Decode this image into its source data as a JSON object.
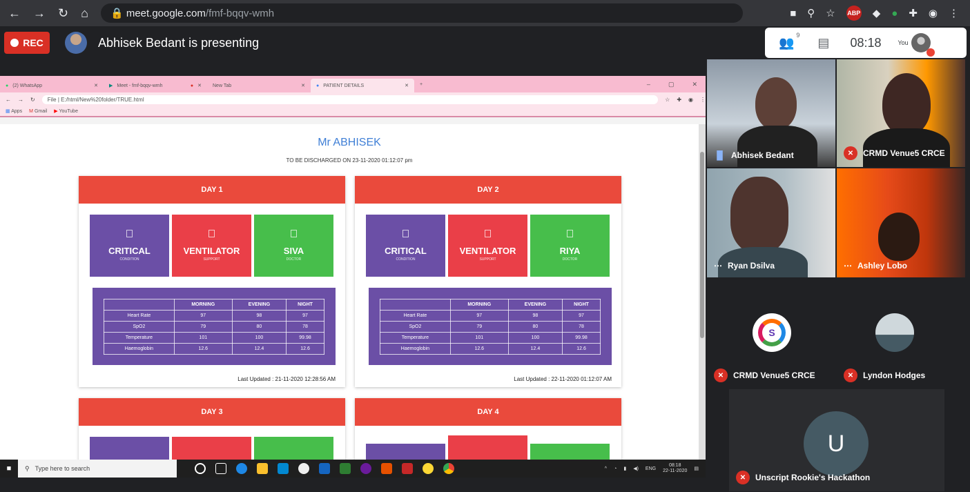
{
  "browser": {
    "url_domain": "meet.google.com",
    "url_path": "/fmf-bqqv-wmh"
  },
  "meet": {
    "rec_label": "REC",
    "presenting_text": "Abhisek Bedant is presenting",
    "participants_count": "9",
    "time": "08:18",
    "you_label": "You"
  },
  "inner_browser": {
    "tabs": [
      {
        "label": "(2) WhatsApp"
      },
      {
        "label": "Meet - fmf-bqqv-wmh"
      },
      {
        "label": "New Tab"
      },
      {
        "label": "PATIENT DETAILS"
      }
    ],
    "address": "File | E:/html/New%20folder/TRUE.html",
    "bookmarks": [
      "Apps",
      "Gmail",
      "YouTube"
    ]
  },
  "patient": {
    "name": "Mr ABHISEK",
    "discharge": "TO BE DISCHARGED ON 23-11-2020 01:12:07 pm"
  },
  "days": [
    {
      "title": "DAY 1",
      "tiles": [
        {
          "title": "CRITICAL",
          "sub": "CONDITION"
        },
        {
          "title": "VENTILATOR",
          "sub": "SUPPORT"
        },
        {
          "title": "SIVA",
          "sub": "DOCTOR"
        }
      ],
      "updated": "Last Updated : 21-11-2020 12:28:56 AM"
    },
    {
      "title": "DAY 2",
      "tiles": [
        {
          "title": "CRITICAL",
          "sub": "CONDITION"
        },
        {
          "title": "VENTILATOR",
          "sub": "SUPPORT"
        },
        {
          "title": "RIYA",
          "sub": "DOCTOR"
        }
      ],
      "updated": "Last Updated : 22-11-2020 01:12:07 AM"
    },
    {
      "title": "DAY 3"
    },
    {
      "title": "DAY 4"
    }
  ],
  "vitals_header": [
    "",
    "MORNING",
    "EVENING",
    "NIGHT"
  ],
  "vitals_rows": [
    [
      "Heart Rate",
      "97",
      "98",
      "97"
    ],
    [
      "SpO2",
      "79",
      "80",
      "78"
    ],
    [
      "Temperature",
      "101",
      "100",
      "99.98"
    ],
    [
      "Haemoglobin",
      "12.6",
      "12.4",
      "12.6"
    ]
  ],
  "taskbar": {
    "search_placeholder": "Type here to search",
    "lang": "ENG",
    "time": "08:18",
    "date": "22-11-2020"
  },
  "participants": [
    {
      "name": "Abhisek Bedant"
    },
    {
      "name": "CRMD Venue5 CRCE"
    },
    {
      "name": "Ryan Dsilva"
    },
    {
      "name": "Ashley Lobo"
    },
    {
      "name": "CRMD Venue5 CRCE"
    },
    {
      "name": "Lyndon Hodges"
    },
    {
      "name": "Unscript Rookie's Hackathon",
      "initial": "U"
    }
  ]
}
